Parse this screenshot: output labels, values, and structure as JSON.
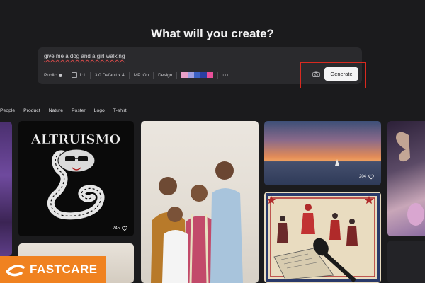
{
  "headline": "What will you create?",
  "prompt": {
    "value": "give me a dog and a girl walking"
  },
  "toolbar": {
    "visibility": "Public",
    "aspect_ratio": "1:1",
    "model": "3.0 Default x 4",
    "mp_label": "MP",
    "mp_value": "On",
    "design_label": "Design",
    "palette": [
      "#e8a0c8",
      "#9d9ee0",
      "#3b62c4",
      "#2a3fa0",
      "#e8509a"
    ],
    "more": "···"
  },
  "generate_button": "Generate",
  "categories": [
    "People",
    "Product",
    "Nature",
    "Poster",
    "Logo",
    "T-shirt"
  ],
  "cobra_title": "ALTRUISMO",
  "gallery_likes": {
    "cobra": "245",
    "sunset": "204"
  },
  "watermark": "FASTCARE"
}
